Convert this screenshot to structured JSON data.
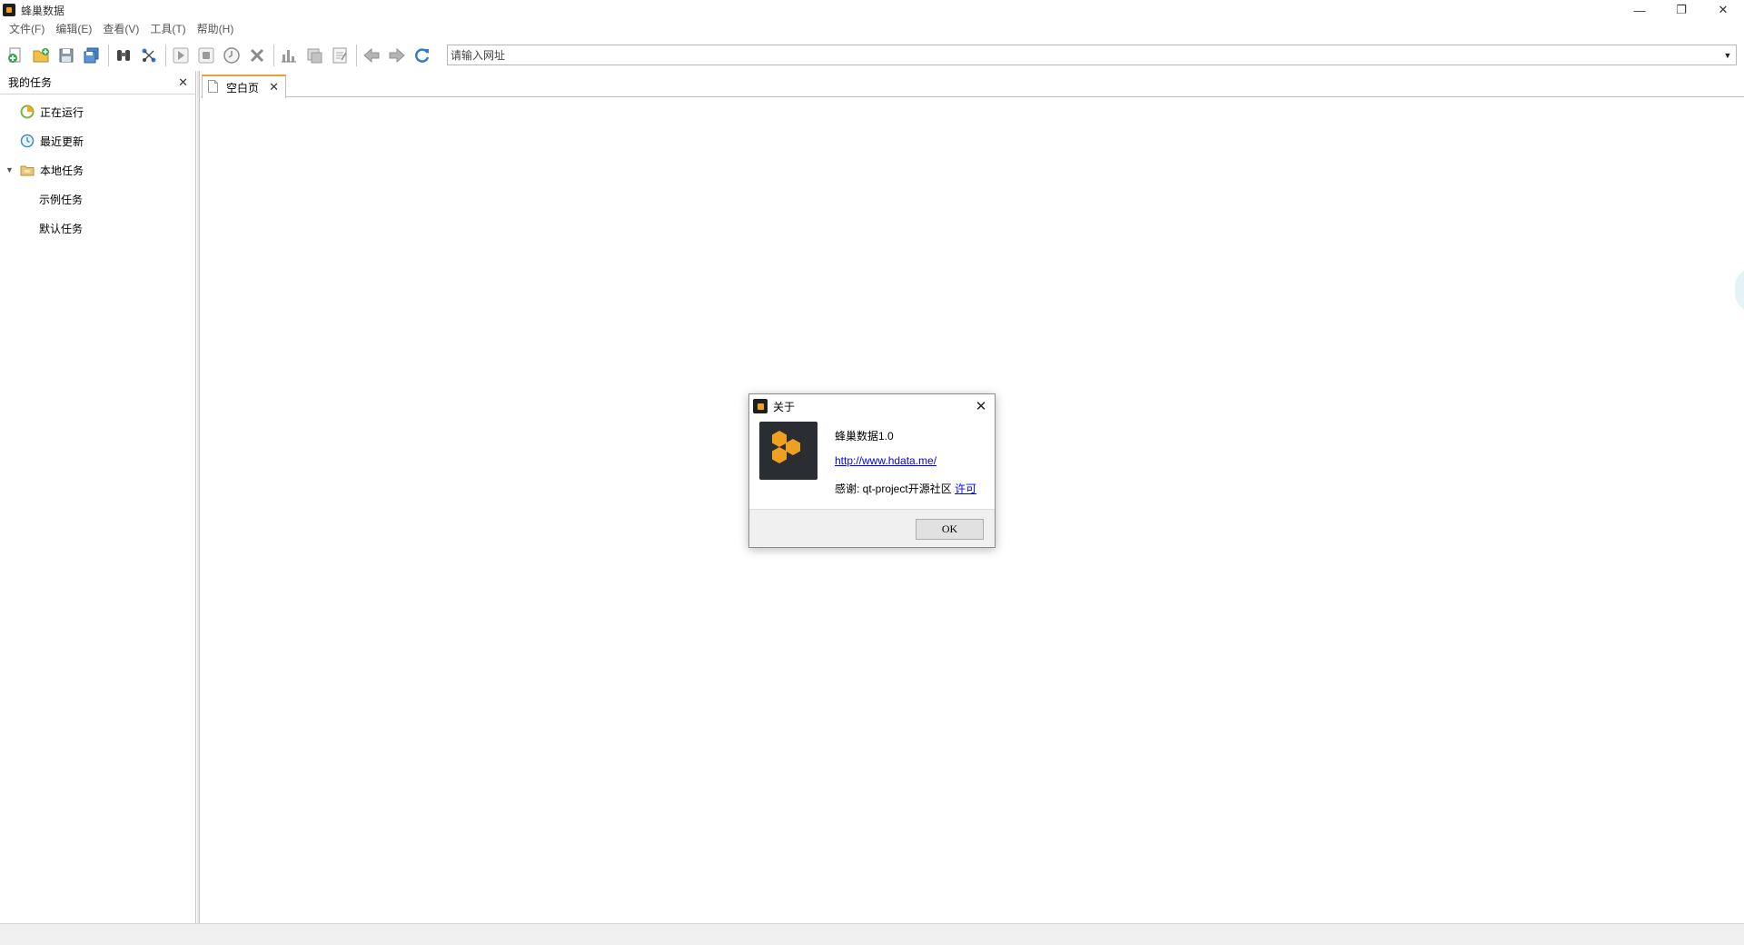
{
  "window": {
    "title": "蜂巢数据",
    "controls": {
      "minimize": "—",
      "restore": "❐",
      "close": "✕"
    }
  },
  "menubar": {
    "items": [
      "文件(F)",
      "编辑(E)",
      "查看(V)",
      "工具(T)",
      "帮助(H)"
    ]
  },
  "toolbar": {
    "icons": [
      "new-task-icon",
      "open-folder-icon",
      "save-icon",
      "save-all-icon",
      "find-icon",
      "edit-network-icon",
      "run-icon",
      "stop-icon",
      "schedule-icon",
      "delete-icon",
      "chart-icon",
      "export-icon",
      "notes-icon",
      "back-arrow-icon",
      "forward-arrow-icon",
      "refresh-icon"
    ],
    "url_placeholder": "请输入网址",
    "accent": "#2e7bcf"
  },
  "left_panel": {
    "title": "我的任务",
    "close": "✕",
    "tree": [
      {
        "label": "正在运行",
        "icon": "running-icon"
      },
      {
        "label": "最近更新",
        "icon": "clock-icon"
      },
      {
        "label": "本地任务",
        "icon": "folder-icon",
        "expanded": true
      },
      {
        "label": "示例任务"
      },
      {
        "label": "默认任务"
      }
    ]
  },
  "tabs": [
    {
      "label": "空白页",
      "close": "✕",
      "active": true
    }
  ],
  "tab_accent": "#e8a33c",
  "about_dialog": {
    "title": "关于",
    "close": "✕",
    "product": "蜂巢数据1.0",
    "url": "http://www.hdata.me/",
    "thanks": "感谢: qt-project开源社区",
    "license_link": "许可",
    "ok": "OK",
    "logo_colors": {
      "background": "#2a2d31",
      "hex": "#f0a020"
    }
  }
}
